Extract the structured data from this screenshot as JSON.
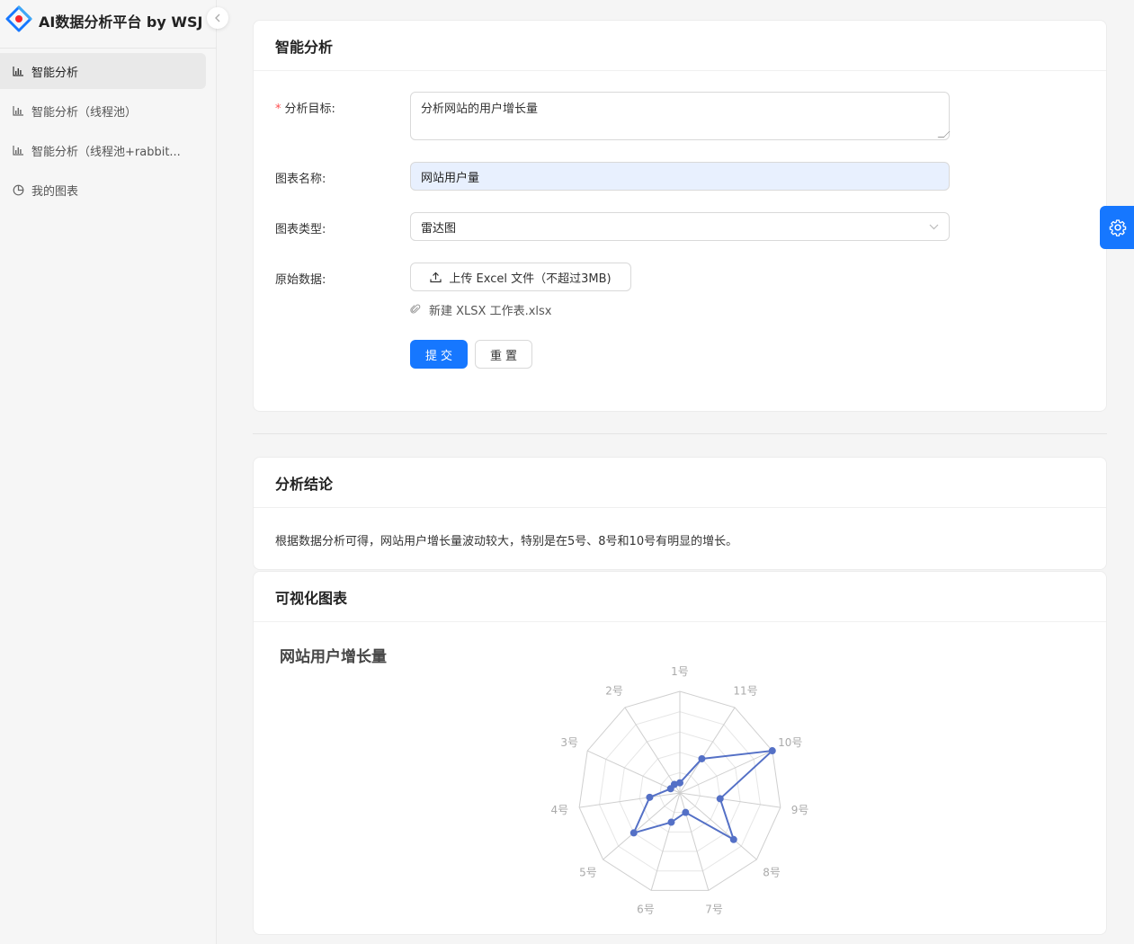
{
  "app": {
    "title": "AI数据分析平台 by WSJ"
  },
  "sidebar": {
    "items": [
      {
        "label": "智能分析",
        "icon": "bar-chart-icon",
        "active": true
      },
      {
        "label": "智能分析（线程池）",
        "icon": "bar-chart-icon",
        "active": false
      },
      {
        "label": "智能分析（线程池+rabbit...",
        "icon": "bar-chart-icon",
        "active": false
      },
      {
        "label": "我的图表",
        "icon": "pie-chart-icon",
        "active": false
      }
    ]
  },
  "form_card": {
    "title": "智能分析",
    "goal_label": "分析目标:",
    "goal_value": "分析网站的用户增长量",
    "name_label": "图表名称:",
    "name_value": "网站用户量",
    "type_label": "图表类型:",
    "type_value": "雷达图",
    "data_label": "原始数据:",
    "upload_label": "上传 Excel 文件（不超过3MB)",
    "file_name": "新建 XLSX 工作表.xlsx",
    "submit_label": "提交",
    "reset_label": "重置"
  },
  "conclusion_card": {
    "title": "分析结论",
    "text": "根据数据分析可得，网站用户增长量波动较大，特别是在5号、8号和10号有明显的增长。"
  },
  "chart_card": {
    "title": "可视化图表"
  },
  "colors": {
    "primary": "#1677ff",
    "series": "#5470c6"
  },
  "chart_data": {
    "type": "radar",
    "title": "网站用户增长量",
    "indicators": [
      "1号",
      "2号",
      "3号",
      "4号",
      "5号",
      "6号",
      "7号",
      "8号",
      "9号",
      "10号",
      "11号"
    ],
    "max": 10,
    "series": [
      {
        "values": [
          1,
          1,
          1,
          3,
          6,
          3,
          2,
          7,
          4,
          10,
          4
        ]
      }
    ]
  }
}
